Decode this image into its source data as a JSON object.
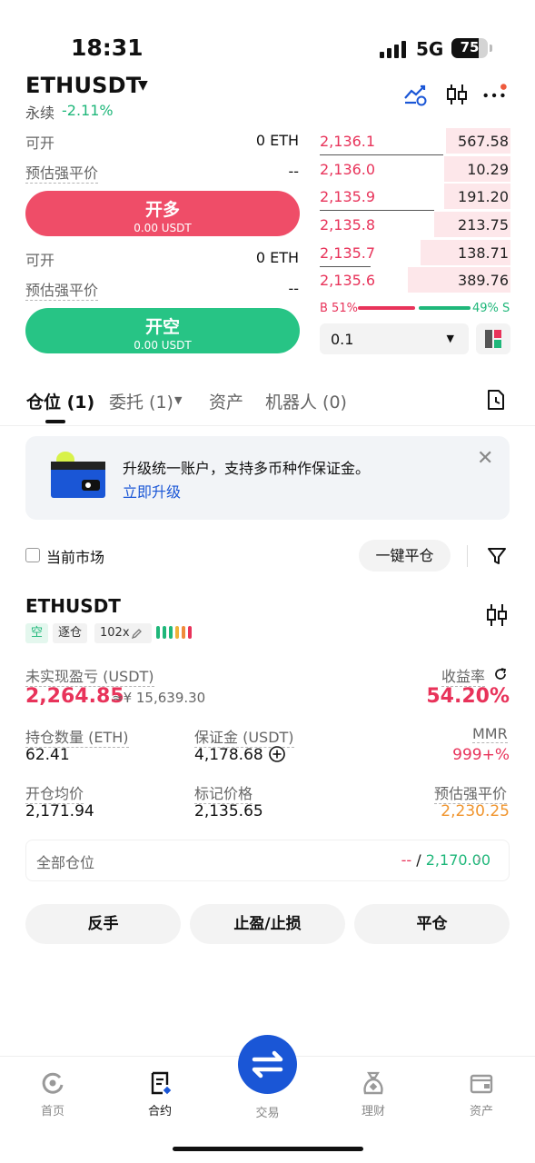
{
  "status_bar": {
    "time": "18:31",
    "network": "5G",
    "battery": "75"
  },
  "header": {
    "symbol": "ETHUSDT",
    "contract_type": "永续",
    "change": "-2.11%"
  },
  "trade": {
    "long": {
      "available_label": "可开",
      "available_value": "0 ETH",
      "liq_label": "预估强平价",
      "liq_value": "--",
      "button_label": "开多",
      "button_amount": "0.00 USDT"
    },
    "short": {
      "available_label": "可开",
      "available_value": "0 ETH",
      "liq_label": "预估强平价",
      "liq_value": "--",
      "button_label": "开空",
      "button_amount": "0.00 USDT"
    }
  },
  "order_book": {
    "asks": [
      {
        "price": "2,136.1",
        "size": "567.58",
        "depth": 0.34
      },
      {
        "price": "2,136.0",
        "size": "10.29",
        "depth": 0.35
      },
      {
        "price": "2,135.9",
        "size": "191.20",
        "depth": 0.35
      },
      {
        "price": "2,135.8",
        "size": "213.75",
        "depth": 0.4
      },
      {
        "price": "2,135.7",
        "size": "138.71",
        "depth": 0.47
      },
      {
        "price": "2,135.6",
        "size": "389.76",
        "depth": 0.54
      }
    ],
    "buy_ratio": "B 51%",
    "sell_ratio": "49% S",
    "quantity_step": "0.1",
    "colors": {
      "ask": "#e8335a",
      "bid": "#1fb77a"
    }
  },
  "tabs": [
    {
      "label": "仓位 (1)"
    },
    {
      "label": "委托 (1)"
    },
    {
      "label": "资产"
    },
    {
      "label": "机器人 (0)"
    }
  ],
  "banner": {
    "text": "升级统一账户，支持多币种作保证金。",
    "link": "立即升级"
  },
  "filter": {
    "current_market": "当前市场",
    "close_all": "一键平仓"
  },
  "position": {
    "symbol": "ETHUSDT",
    "side_tag": "空",
    "margin_mode": "逐仓",
    "leverage": "102x",
    "unrealized_pnl_label": "未实现盈亏 (USDT)",
    "unrealized_pnl": "2,264.85",
    "unrealized_pnl_cny": "≈¥ 15,639.30",
    "roe_label": "收益率",
    "roe": "54.20%",
    "size_label": "持仓数量 (ETH)",
    "size": "62.41",
    "margin_label": "保证金 (USDT)",
    "margin": "4,178.68",
    "mmr_label": "MMR",
    "mmr": "999+%",
    "entry_label": "开仓均价",
    "entry": "2,171.94",
    "mark_label": "标记价格",
    "mark": "2,135.65",
    "liq_label": "预估强平价",
    "liq": "2,230.25",
    "all_positions_label": "全部仓位",
    "all_positions_left": "--",
    "all_positions_sep": " / ",
    "all_positions_right": "2,170.00"
  },
  "actions": {
    "reverse": "反手",
    "tpsl": "止盈/止损",
    "close": "平仓"
  },
  "bottom_nav": [
    {
      "label": "首页",
      "icon": "home-icon"
    },
    {
      "label": "合约",
      "icon": "contract-icon"
    },
    {
      "label": "交易",
      "icon": "swap-icon"
    },
    {
      "label": "理财",
      "icon": "earn-icon"
    },
    {
      "label": "资产",
      "icon": "wallet-icon"
    }
  ]
}
